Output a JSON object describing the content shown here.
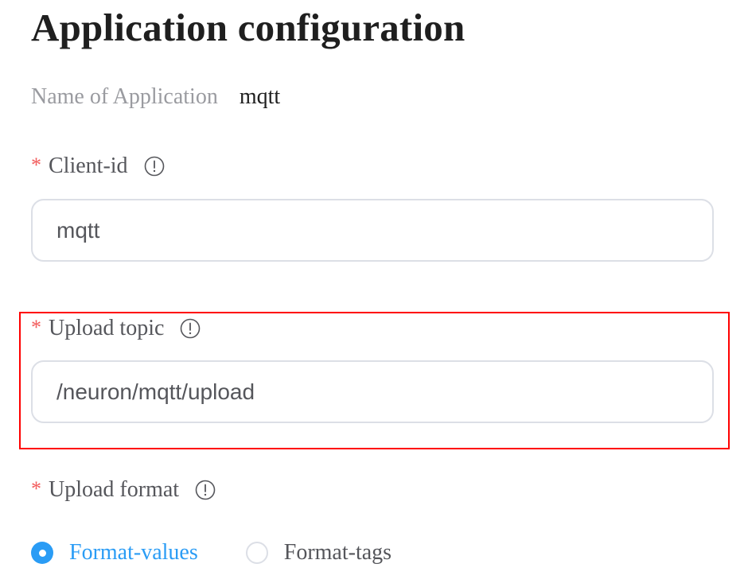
{
  "page": {
    "title": "Application configuration"
  },
  "app_name": {
    "label": "Name of Application",
    "value": "mqtt"
  },
  "fields": {
    "client_id": {
      "required_mark": "*",
      "label": "Client-id",
      "info_icon": "info-circle-icon",
      "value": "mqtt"
    },
    "upload_topic": {
      "required_mark": "*",
      "label": "Upload topic",
      "info_icon": "info-circle-icon",
      "value": "/neuron/mqtt/upload",
      "highlighted": true
    },
    "upload_format": {
      "required_mark": "*",
      "label": "Upload format",
      "info_icon": "info-circle-icon",
      "options": [
        {
          "label": "Format-values",
          "selected": true
        },
        {
          "label": "Format-tags",
          "selected": false
        }
      ]
    }
  },
  "colors": {
    "accent": "#2a9cf5",
    "required": "#f25a5a",
    "highlight": "#ff0000",
    "input_border": "#dcdfe6",
    "label_text": "#55565b",
    "muted_text": "#9a9ba0",
    "title_text": "#1f1f1f"
  }
}
